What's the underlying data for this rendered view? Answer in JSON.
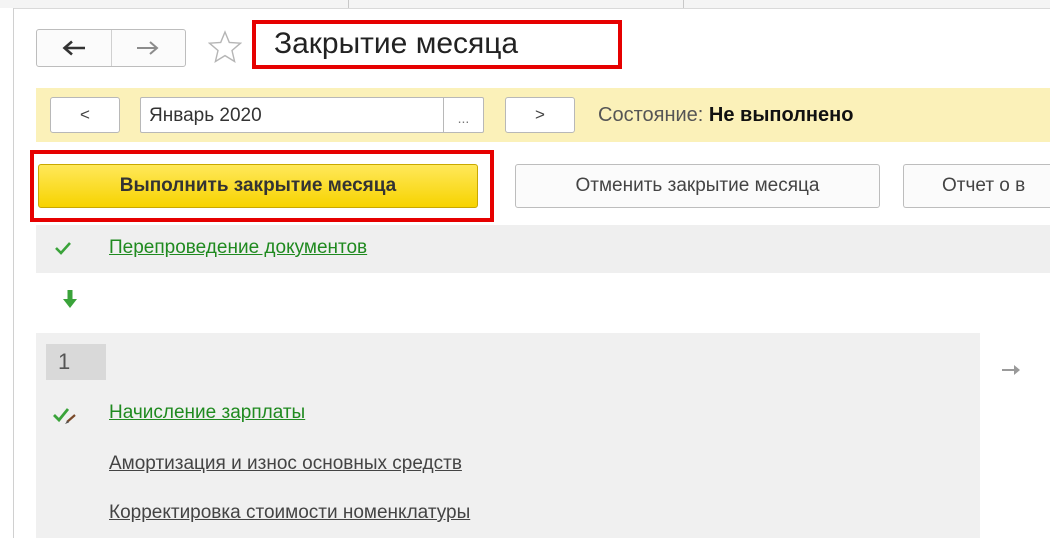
{
  "window": {
    "title": "Закрытие месяца"
  },
  "navigation": {
    "back_icon": "arrow-left-icon",
    "forward_icon": "arrow-right-icon",
    "favorite_icon": "star-icon"
  },
  "period": {
    "prev_label": "<",
    "next_label": ">",
    "value": "Январь 2020",
    "select_label": "...",
    "status_label": "Состояние:",
    "status_value": "Не выполнено"
  },
  "actions": {
    "execute_label": "Выполнить закрытие месяца",
    "cancel_label": "Отменить закрытие месяца",
    "report_label": "Отчет о в"
  },
  "stages": {
    "stage0": {
      "item": "Перепроведение документов",
      "status_icon": "check-icon"
    },
    "stage1": {
      "number": "1",
      "items": [
        "Начисление зарплаты",
        "Амортизация и износ основных средств",
        "Корректировка стоимости номенклатуры"
      ]
    }
  },
  "colors": {
    "highlight_frame": "#e60000",
    "period_bar": "#fbf1b9",
    "execute_button": "#f7d300",
    "done_link": "#1f8a1f",
    "check": "#3aa33a"
  }
}
